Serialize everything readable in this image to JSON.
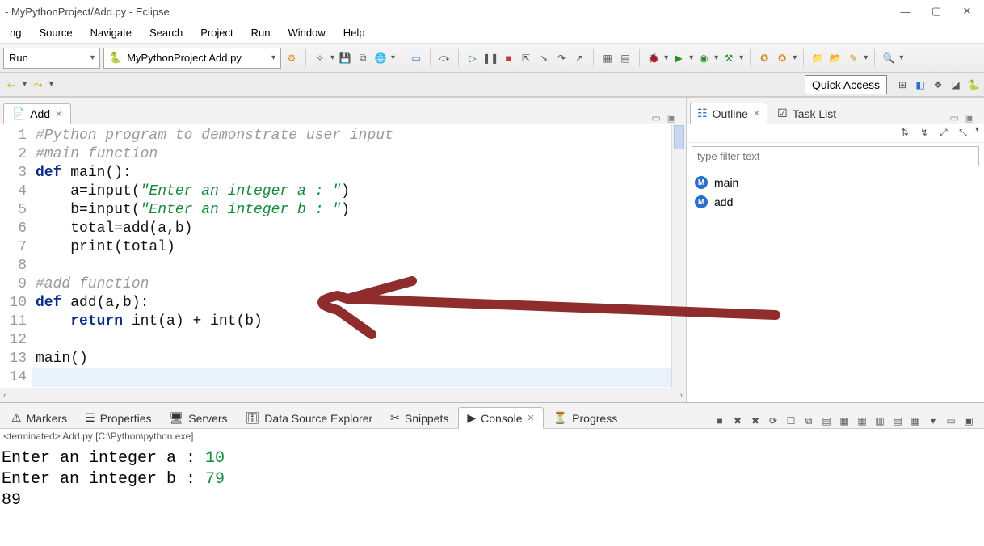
{
  "windowTitle": "- MyPythonProject/Add.py - Eclipse",
  "menus": [
    "ng",
    "Source",
    "Navigate",
    "Search",
    "Project",
    "Run",
    "Window",
    "Help"
  ],
  "runCombo": "Run",
  "projectCombo": "MyPythonProject Add.py",
  "quickAccess": "Quick Access",
  "editor": {
    "tabLabel": "Add",
    "lines": [
      {
        "n": "1",
        "html": "<span class='c-comment'>#Python program to demonstrate user input</span>"
      },
      {
        "n": "2",
        "html": "<span class='c-comment'>#main function</span>"
      },
      {
        "n": "3",
        "html": "<span class='c-kw'>def</span> <span class='c-func'>main</span>():"
      },
      {
        "n": "4",
        "html": "    a=input(<span class='c-str'>\"Enter an integer a : \"</span>)"
      },
      {
        "n": "5",
        "html": "    b=input(<span class='c-str'>\"Enter an integer b : \"</span>)"
      },
      {
        "n": "6",
        "html": "    total=add(a,b)"
      },
      {
        "n": "7",
        "html": "    print(total)"
      },
      {
        "n": "8",
        "html": ""
      },
      {
        "n": "9",
        "html": "<span class='c-comment'>#add function</span>"
      },
      {
        "n": "10",
        "html": "<span class='c-kw'>def</span> <span class='c-func'>add</span>(a,b):"
      },
      {
        "n": "11",
        "html": "    <span class='c-kw'>return</span> int(a) + int(b)"
      },
      {
        "n": "12",
        "html": ""
      },
      {
        "n": "13",
        "html": "main()"
      },
      {
        "n": "14",
        "html": ""
      }
    ]
  },
  "outline": {
    "title": "Outline",
    "taskList": "Task List",
    "filterPlaceholder": "type filter text",
    "items": [
      "main",
      "add"
    ]
  },
  "bottomTabs": [
    "Markers",
    "Properties",
    "Servers",
    "Data Source Explorer",
    "Snippets",
    "Console",
    "Progress"
  ],
  "bottomActive": 5,
  "terminatedLine": "<terminated> Add.py [C:\\Python\\python.exe]",
  "console": [
    {
      "prompt": "Enter an integer a : ",
      "val": "10"
    },
    {
      "prompt": "Enter an integer b : ",
      "val": "79"
    },
    {
      "prompt": "89",
      "val": ""
    }
  ]
}
